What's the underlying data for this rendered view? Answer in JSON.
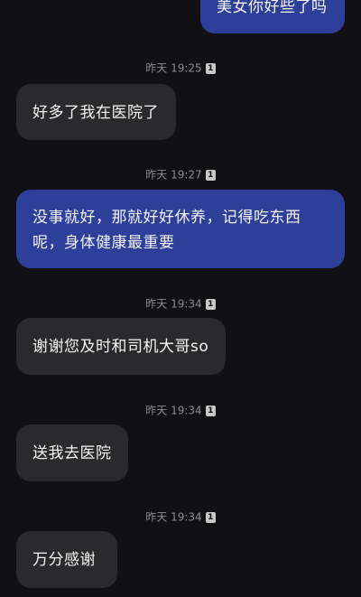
{
  "messages": [
    {
      "direction": "out",
      "text": "美女你好些了吗"
    },
    {
      "direction": "in",
      "text": "好多了我在医院了"
    },
    {
      "direction": "out",
      "text": "没事就好，那就好好休养，记得吃东西呢，身体健康最重要"
    },
    {
      "direction": "in",
      "text": "谢谢您及时和司机大哥so"
    },
    {
      "direction": "in",
      "text": "送我去医院"
    },
    {
      "direction": "in",
      "text": "万分感谢"
    }
  ],
  "timestamps": [
    {
      "time": "昨天 19:25",
      "count": "1"
    },
    {
      "time": "昨天 19:27",
      "count": "1"
    },
    {
      "time": "昨天 19:34",
      "count": "1"
    },
    {
      "time": "昨天 19:34",
      "count": "1"
    },
    {
      "time": "昨天 19:34",
      "count": "1"
    }
  ],
  "colors": {
    "background": "#111113",
    "incoming_bubble": "#2a2a2c",
    "outgoing_bubble": "#2e3f9a",
    "timestamp_text": "#8a8a8e"
  }
}
